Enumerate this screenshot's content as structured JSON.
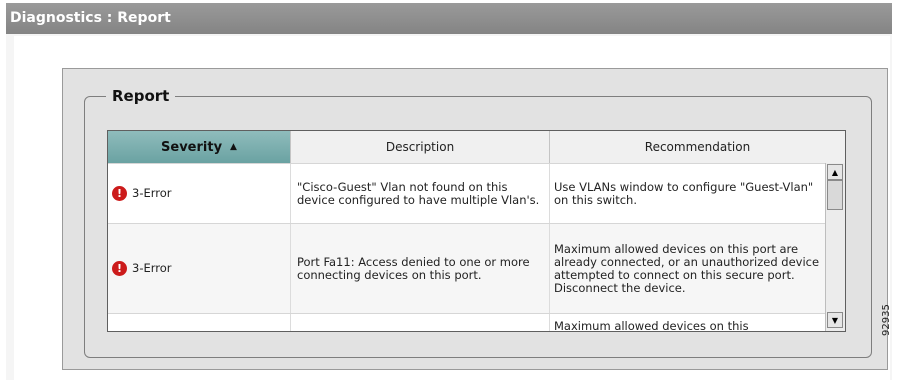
{
  "header": {
    "title": "Diagnostics : Report"
  },
  "panel": {
    "legend": "Report"
  },
  "table": {
    "columns": [
      {
        "label": "Severity",
        "sorted": "ascending"
      },
      {
        "label": "Description"
      },
      {
        "label": "Recommendation"
      }
    ],
    "rows": [
      {
        "severity": "3-Error",
        "description": "\"Cisco-Guest\" Vlan not found on this device configured to have multiple Vlan's.",
        "recommendation": "Use VLANs window to configure \"Guest-Vlan\" on this switch."
      },
      {
        "severity": "3-Error",
        "description": "Port Fa11: Access denied to one or more connecting devices on this port.",
        "recommendation": "Maximum allowed devices on this port are already connected, or an unauthorized device attempted to connect on this secure port. Disconnect the device."
      },
      {
        "severity": "",
        "description": "",
        "recommendation": "Maximum allowed devices on this"
      }
    ]
  },
  "icons": {
    "sort": "triangle-up-icon",
    "severity": "error-icon"
  },
  "colors": {
    "titlebar": "#8c8c8c",
    "sorted_header": "#7aaeae",
    "error": "#cc1b1b"
  },
  "figure_id": "92935"
}
